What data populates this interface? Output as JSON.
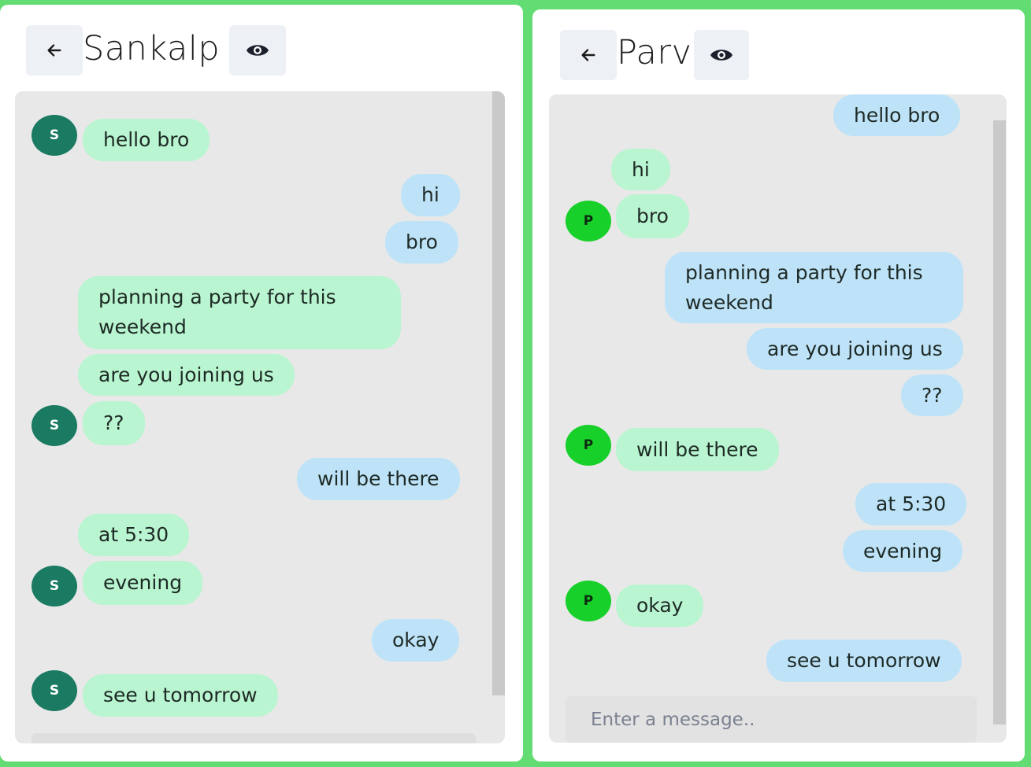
{
  "colors": {
    "background": "#63dc73",
    "received_bubble": "#b9f5d0",
    "sent_bubble": "#bee3f8",
    "avatar_s": "#1a7a62",
    "avatar_p": "#18d02a"
  },
  "left_chat": {
    "title": "Sankalp",
    "back_icon": "arrow-left-icon",
    "view_icon": "eye-icon",
    "avatar_initial": "S",
    "messages": [
      {
        "text": "hello bro",
        "direction": "received"
      },
      {
        "text": "hi",
        "direction": "sent"
      },
      {
        "text": "bro",
        "direction": "sent"
      },
      {
        "text": "planning a party for this weekend",
        "direction": "received"
      },
      {
        "text": "are you joining us",
        "direction": "received"
      },
      {
        "text": "??",
        "direction": "received"
      },
      {
        "text": "will be there",
        "direction": "sent"
      },
      {
        "text": "at 5:30",
        "direction": "received"
      },
      {
        "text": "evening",
        "direction": "received"
      },
      {
        "text": "okay",
        "direction": "sent"
      },
      {
        "text": "see u tomorrow",
        "direction": "received"
      }
    ]
  },
  "right_chat": {
    "title": "Parv",
    "back_icon": "arrow-left-icon",
    "view_icon": "eye-icon",
    "avatar_initial": "P",
    "messages": [
      {
        "text": "hello bro",
        "direction": "sent"
      },
      {
        "text": "hi",
        "direction": "received"
      },
      {
        "text": "bro",
        "direction": "received"
      },
      {
        "text": "planning a party for this weekend",
        "direction": "sent"
      },
      {
        "text": "are you joining us",
        "direction": "sent"
      },
      {
        "text": "??",
        "direction": "sent"
      },
      {
        "text": "will be there",
        "direction": "received"
      },
      {
        "text": "at 5:30",
        "direction": "sent"
      },
      {
        "text": "evening",
        "direction": "sent"
      },
      {
        "text": "okay",
        "direction": "received"
      },
      {
        "text": "see u tomorrow",
        "direction": "sent"
      }
    ],
    "input_placeholder": "Enter a message.."
  }
}
